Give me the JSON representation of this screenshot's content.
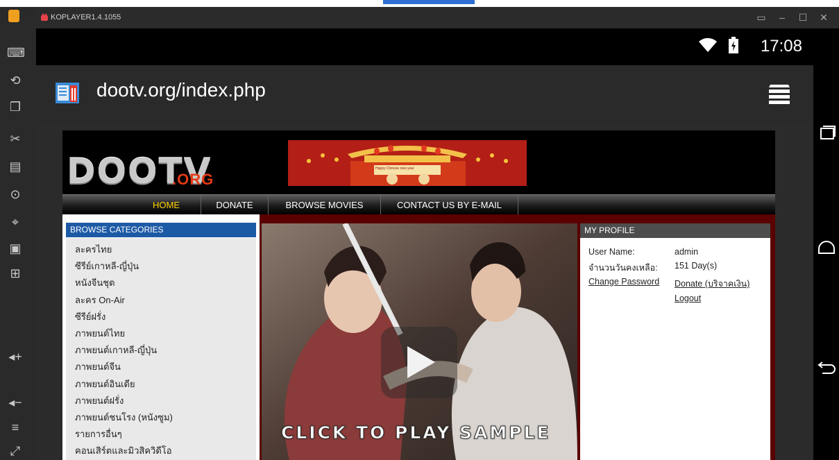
{
  "emulator": {
    "title": "KOPLAYER1.4.1055",
    "controls": [
      "▭",
      "–",
      "☐",
      "✕"
    ],
    "toolbar_icons": [
      "keyboard-icon",
      "shake-icon",
      "screenshot-icon",
      "cut-icon",
      "folder-icon",
      "location-icon",
      "gps-icon",
      "camera-icon",
      "apk-icon",
      "volume-up-icon",
      "volume-down-icon",
      "menu-icon",
      "fullscreen-icon"
    ]
  },
  "status_bar": {
    "time": "17:08",
    "icons": [
      "wifi-icon",
      "battery-icon"
    ]
  },
  "browser": {
    "url": "dootv.org/index.php",
    "menu_icon": "menu-icon"
  },
  "site": {
    "logo": "DOOTV",
    "logo_suffix": ".ORG",
    "banner_text": "Happy Chinese new year",
    "nav": [
      {
        "label": "HOME",
        "active": true
      },
      {
        "label": "DONATE",
        "active": false
      },
      {
        "label": "BROWSE MOVIES",
        "active": false
      },
      {
        "label": "CONTACT US BY E-MAIL",
        "active": false
      }
    ],
    "categories": {
      "title": "BROWSE CATEGORIES",
      "items": [
        "ละครไทย",
        "ซีรีย์เกาหลี-ญี่ปุ่น",
        "หนังจีนชุด",
        "ละคร On-Air",
        "ซีรีย์ฝรั่ง",
        "ภาพยนต์ไทย",
        "ภาพยนต์เกาหลี-ญี่ปุ่น",
        "ภาพยนต์จีน",
        "ภาพยนต์อินเดีย",
        "ภาพยนต์ฝรั่ง",
        "ภาพยนต์ชนโรง (หนังซูม)",
        "รายการอื่นๆ",
        "คอนเสิร์ตและมิวสิควิดีโอ"
      ]
    },
    "video": {
      "cta": "CLICK TO PLAY SAMPLE"
    },
    "profile": {
      "title": "MY PROFILE",
      "username_label": "User Name:",
      "username_value": "admin",
      "days_label": "จำนวนวันคงเหลือ:",
      "days_value": "151 Day(s)",
      "change_password": "Change Password",
      "donate": "Donate (บริจาคเงิน)",
      "logout": "Logout"
    }
  },
  "colors": {
    "active_nav": "#ffd200",
    "categories_header": "#1d5aa6",
    "link": "#1b3cb4",
    "content_bg": "#5a0000",
    "logo_suffix": "#e53a14"
  }
}
